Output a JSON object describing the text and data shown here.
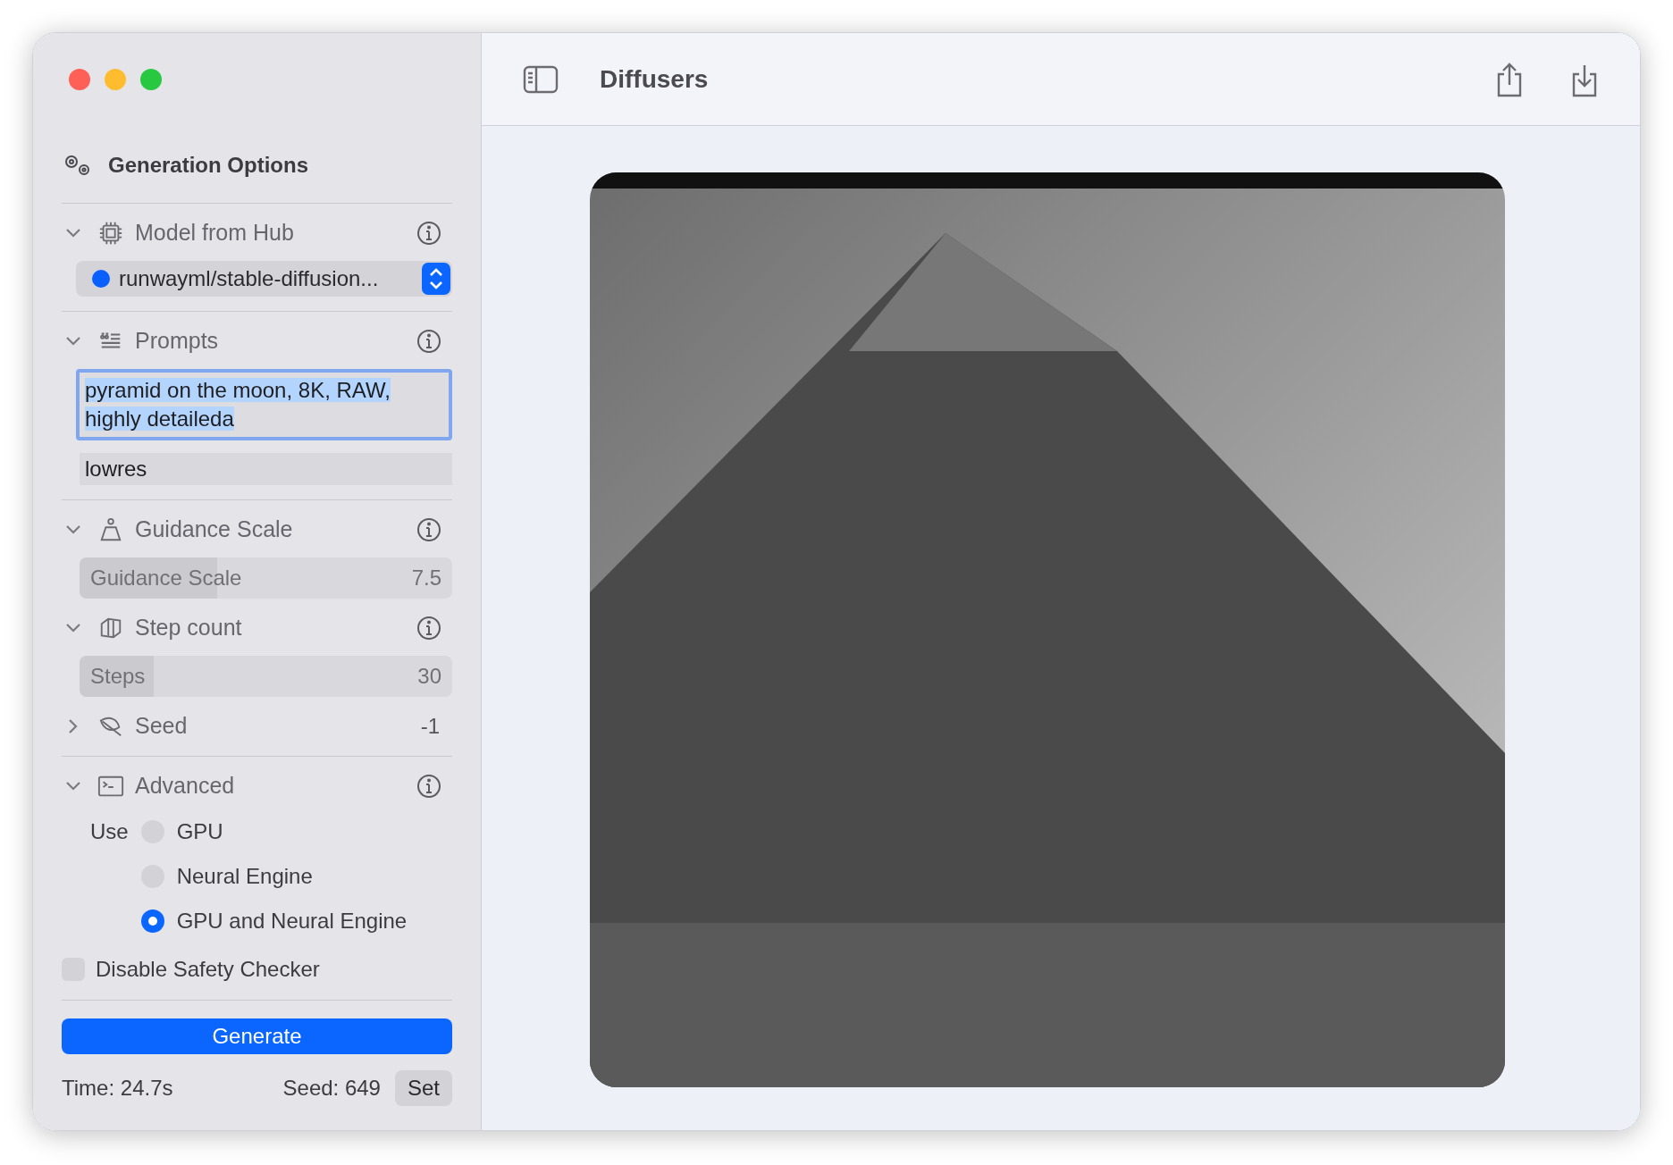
{
  "window": {
    "title": "Diffusers"
  },
  "sidebar": {
    "title": "Generation Options",
    "sections": [
      {
        "kind": "picker",
        "title": "Model from Hub",
        "expanded": true,
        "info_button": true,
        "divider": true,
        "model": {
          "value": "runwayml/stable-diffusion...",
          "color": "#0a60ff"
        }
      },
      {
        "kind": "prompts",
        "title": "Prompts",
        "expanded": true,
        "info_button": true,
        "divider": true,
        "prompt": {
          "value": "pyramid on the moon, 8K, RAW, highly detaileda",
          "selected": true
        },
        "negative_prompt": {
          "value": "lowres",
          "selected": false
        }
      },
      {
        "kind": "slider",
        "title": "Guidance Scale",
        "expanded": true,
        "info_button": true,
        "divider": false,
        "slider": {
          "label": "Guidance Scale",
          "reading": "7.5",
          "level": 0.37
        }
      },
      {
        "kind": "slider",
        "title": "Step count",
        "expanded": true,
        "info_button": true,
        "divider": false,
        "slider": {
          "label": "Steps",
          "reading": "30",
          "level": 0.2
        }
      },
      {
        "kind": "value",
        "title": "Seed",
        "expanded": false,
        "info_button": false,
        "divider": true,
        "value": "-1"
      },
      {
        "kind": "advanced",
        "title": "Advanced",
        "expanded": true,
        "info_button": true,
        "divider": true,
        "use_label": "Use",
        "options": [
          {
            "label": "GPU",
            "selected": false
          },
          {
            "label": "Neural Engine",
            "selected": false
          },
          {
            "label": "GPU and Neural Engine",
            "selected": true
          }
        ],
        "checkbox": {
          "label": "Disable Safety Checker",
          "checked": false
        }
      }
    ],
    "generate_button": "Generate",
    "footer": {
      "time": "Time: 24.7s",
      "seed": "Seed: 649",
      "set_button": "Set"
    }
  }
}
